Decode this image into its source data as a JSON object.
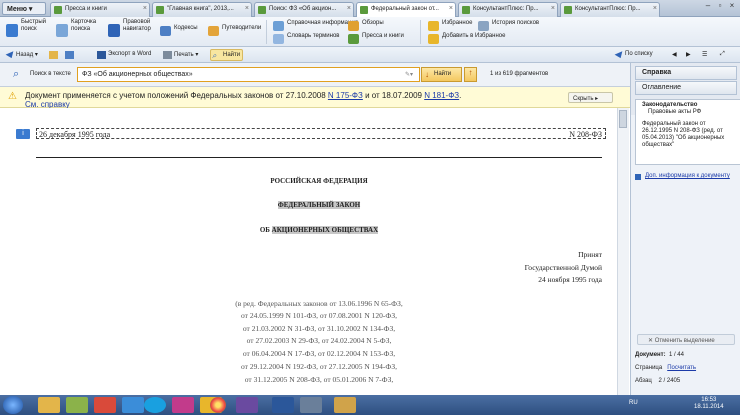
{
  "tabbar": {
    "menu": "Меню",
    "tabs": [
      "Пресса и книги",
      "\"Главная книга\", 2013,...",
      "Поиск: ФЗ «Об акцион...",
      "Федеральный закон от...",
      "КонсультантПлюс: Пр...",
      "КонсультантПлюс: Пр..."
    ]
  },
  "quickbar": {
    "big": [
      "Быстрый поиск",
      "Карточка поиска",
      "Правовой навигатор"
    ],
    "small": [
      "Кодексы",
      "Путеводители",
      "Справочная информация",
      "Словарь терминов",
      "Обзоры",
      "Пресса и книги",
      "Избранное",
      "Добавить в Избранное",
      "История поисков"
    ]
  },
  "navbar": {
    "back": "Назад",
    "word": "Экспорт в Word",
    "print": "Печать",
    "find": "Найти",
    "by_list": "По списку"
  },
  "search": {
    "label": "Поиск в тексте",
    "query": "ФЗ  «Об акционерных обществах»",
    "button": "Найти",
    "fragments": "1 из 619 фрагментов"
  },
  "notice": {
    "text_pre": "Документ применяется с учетом положений Федеральных законов от 27.10.2008 ",
    "link1": "N 175-ФЗ",
    "text_mid": " и от 18.07.2009 ",
    "link2": "N 181-ФЗ",
    "text_post": ".",
    "help": "См. справку",
    "hide": "Скрыть"
  },
  "doc": {
    "date": "26 декабря 1995 года",
    "number": "N 208-ФЗ",
    "country": "РОССИЙСКАЯ ФЕДЕРАЦИЯ",
    "law_type": "ФЕДЕРАЛЬНЫЙ ЗАКОН",
    "law_title_pre": "ОБ ",
    "law_title_hl": "АКЦИОНЕРНЫХ ОБЩЕСТВАХ",
    "adopted": [
      "Принят",
      "Государственной Думой",
      "24 ноября 1995 года"
    ],
    "editions": [
      "(в ред. Федеральных законов от 13.06.1996 N 65-ФЗ,",
      "от 24.05.1999 N 101-ФЗ, от 07.08.2001 N 120-ФЗ,",
      "от 21.03.2002 N 31-ФЗ, от 31.10.2002 N 134-ФЗ,",
      "от 27.02.2003 N 29-ФЗ, от 24.02.2004 N 5-ФЗ,",
      "от 06.04.2004 N 17-ФЗ, от 02.12.2004 N 153-ФЗ,",
      "от 29.12.2004 N 192-ФЗ, от 27.12.2005 N 194-ФЗ,",
      "от 31.12.2005 N 208-ФЗ, от 05.01.2006 N 7-ФЗ,"
    ]
  },
  "rpanel": {
    "ref": "Справка",
    "toc": "Оглавление",
    "section": "Законодательство",
    "subsection": "Правовые акты РФ",
    "info": "Федеральный закон от 26.12.1995 N 208-ФЗ (ред. от 05.04.2013) \"Об акционерных обществах\"",
    "more": "Доп. информация к документу",
    "cancel": "Отменить выделение",
    "doc_label": "Документ:",
    "doc_value": "1 / 44",
    "page_label": "Страница",
    "page_value": "Посчитать",
    "par_label": "Абзац",
    "par_value": "2 / 2405"
  },
  "taskbar": {
    "lang": "RU",
    "time": "16:53",
    "date": "18.11.2014"
  }
}
